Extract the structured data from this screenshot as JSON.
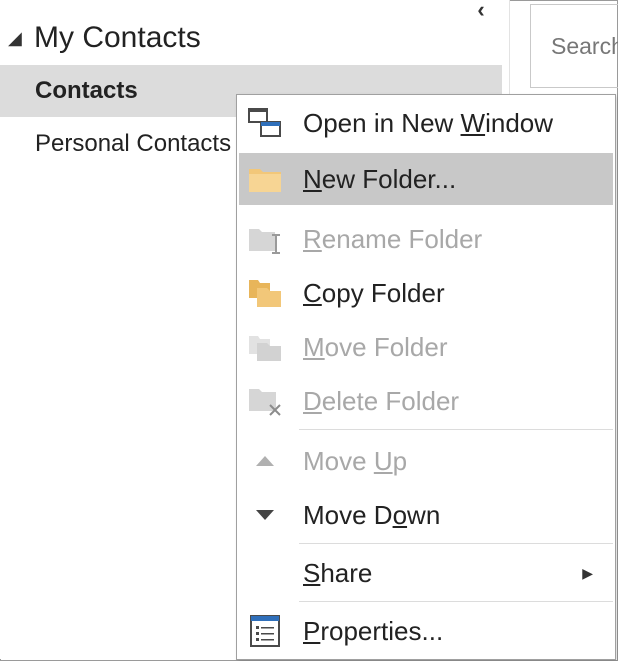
{
  "nav": {
    "group_label": "My Contacts",
    "group_arrow": "◢",
    "collapse_glyph": "‹",
    "folders": [
      "Contacts",
      "Personal Contacts"
    ]
  },
  "search": {
    "placeholder": "Search"
  },
  "context_menu": {
    "items": [
      {
        "pre": "Open in New ",
        "acc": "W",
        "post": "indow",
        "enabled": true,
        "icon": "open-window-icon"
      },
      {
        "pre": "",
        "acc": "N",
        "post": "ew Folder...",
        "enabled": true,
        "icon": "new-folder-icon"
      },
      {
        "pre": "",
        "acc": "R",
        "post": "ename Folder",
        "enabled": false,
        "icon": "rename-folder-icon"
      },
      {
        "pre": "",
        "acc": "C",
        "post": "opy Folder",
        "enabled": true,
        "icon": "copy-folder-icon"
      },
      {
        "pre": "",
        "acc": "M",
        "post": "ove Folder",
        "enabled": false,
        "icon": "move-folder-icon"
      },
      {
        "pre": "",
        "acc": "D",
        "post": "elete Folder",
        "enabled": false,
        "icon": "delete-folder-icon"
      },
      {
        "pre": "Move ",
        "acc": "U",
        "post": "p",
        "enabled": false,
        "icon": "move-up-icon"
      },
      {
        "pre": "Move D",
        "acc": "o",
        "post": "wn",
        "enabled": true,
        "icon": "move-down-icon"
      },
      {
        "pre": "",
        "acc": "S",
        "post": "hare",
        "enabled": true,
        "icon": "share",
        "submenu_arrow": "▶"
      },
      {
        "pre": "",
        "acc": "P",
        "post": "roperties...",
        "enabled": true,
        "icon": "properties-icon"
      }
    ],
    "highlighted": "New Folder..."
  },
  "colors": {
    "highlight": "#c8c8c8",
    "folder": "#f2c779",
    "disabled": "#a8a8a8",
    "selected_folder_bg": "#dcdcdc"
  }
}
